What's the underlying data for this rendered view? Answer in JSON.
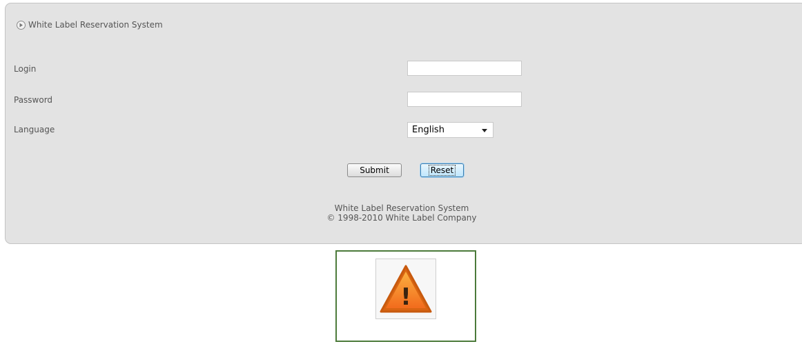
{
  "header": {
    "title": "White Label Reservation System",
    "icon": "play-circle-icon"
  },
  "form": {
    "login_label": "Login",
    "login_value": "",
    "password_label": "Password",
    "password_value": "",
    "language_label": "Language",
    "language_selected": "English"
  },
  "buttons": {
    "submit_label": "Submit",
    "reset_label": "Reset"
  },
  "footer": {
    "line1": "White Label Reservation System",
    "line2": "© 1998-2010 White Label Company"
  },
  "warning": {
    "icon": "warning-icon",
    "glyph": "!"
  },
  "colors": {
    "panel_bg": "#e3e3e3",
    "warning_orange": "#f7931e",
    "frame_green": "#4b7a3a"
  }
}
